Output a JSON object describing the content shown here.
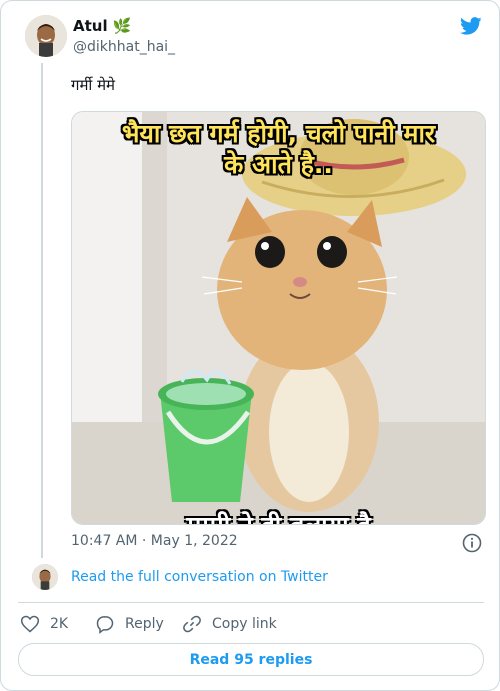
{
  "author": {
    "name": "Atul 🌿",
    "handle": "@dikhhat_hai_"
  },
  "tweet": {
    "text": "गर्मी मेमे"
  },
  "media": {
    "caption_top": "भैया छत गर्म होगी, चलो पानी मार",
    "caption_top_2": "के आते है..",
    "caption_bottom": "मम्मी ने ही बुलाया है"
  },
  "meta": {
    "timestamp": "10:47 AM · May 1, 2022"
  },
  "conversation": {
    "link_text": "Read the full conversation on Twitter"
  },
  "actions": {
    "likes": "2K",
    "reply": "Reply",
    "copy": "Copy link"
  },
  "footer": {
    "read_replies": "Read 95 replies"
  },
  "colors": {
    "accent": "#1d9bf0",
    "muted": "#536471",
    "border": "#cfd9de",
    "caption": "#ffe35a"
  },
  "icons": [
    "twitter-bird-icon",
    "info-icon",
    "heart-icon",
    "reply-icon",
    "link-icon"
  ]
}
